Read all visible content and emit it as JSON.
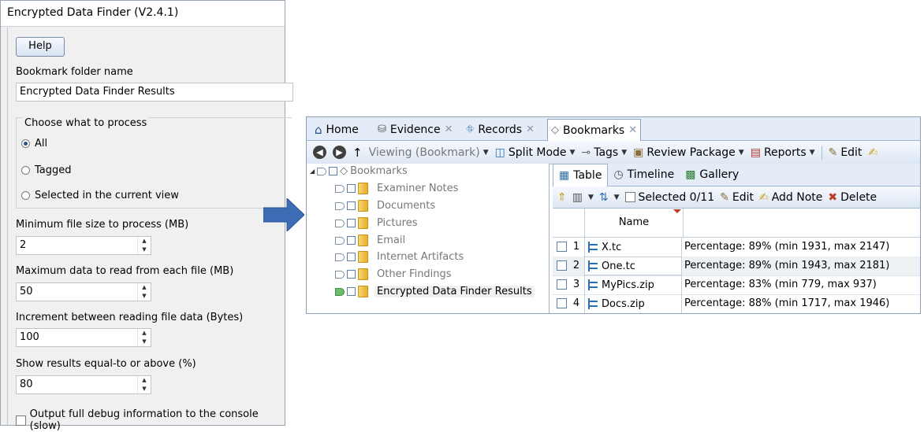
{
  "dialog": {
    "title": "Encrypted Data Finder (V2.4.1)",
    "help_label": "Help",
    "bookmark_label": "Bookmark folder name",
    "bookmark_value": "Encrypted Data Finder Results",
    "process_legend": "Choose what to process",
    "options": [
      "All",
      "Tagged",
      "Selected in the current view"
    ],
    "selected_option": "All",
    "min_size_label": "Minimum file size to process (MB)",
    "min_size_value": "2",
    "max_data_label": "Maximum data to read from each file (MB)",
    "max_data_value": "50",
    "increment_label": "Increment between reading file data (Bytes)",
    "increment_value": "100",
    "threshold_label": "Show results equal-to or above (%)",
    "threshold_value": "80",
    "debug_label": "Output full debug information to the console (slow)"
  },
  "app": {
    "tabs": [
      {
        "label": "Home"
      },
      {
        "label": "Evidence"
      },
      {
        "label": "Records"
      },
      {
        "label": "Bookmarks"
      }
    ],
    "toolbar": {
      "viewing": "Viewing (Bookmark)",
      "split_mode": "Split Mode",
      "tags": "Tags",
      "review_package": "Review Package",
      "reports": "Reports",
      "edit": "Edit"
    },
    "tree": {
      "root": "Bookmarks",
      "items": [
        "Examiner Notes",
        "Documents",
        "Pictures",
        "Email",
        "Internet Artifacts",
        "Other Findings",
        "Encrypted Data Finder Results"
      ]
    },
    "subtabs": [
      "Table",
      "Timeline",
      "Gallery"
    ],
    "subtoolbar": {
      "selected": "Selected 0/11",
      "edit": "Edit",
      "add_note": "Add Note",
      "delete": "Delete"
    },
    "table": {
      "name_header": "Name",
      "rows": [
        {
          "num": "1",
          "name": "X.tc",
          "desc": "Percentage: 89% (min 1931, max 2147)"
        },
        {
          "num": "2",
          "name": "One.tc",
          "desc": "Percentage: 89% (min 1943, max 2181)"
        },
        {
          "num": "3",
          "name": "MyPics.zip",
          "desc": "Percentage: 83% (min 779, max 937)"
        },
        {
          "num": "4",
          "name": "Docs.zip",
          "desc": "Percentage: 88% (min 1717, max 1946)"
        }
      ]
    }
  },
  "colors": {
    "arrow": "#3d6cb5",
    "tab_bg": "#e4ecf7",
    "accent": "#2f6fb3"
  }
}
